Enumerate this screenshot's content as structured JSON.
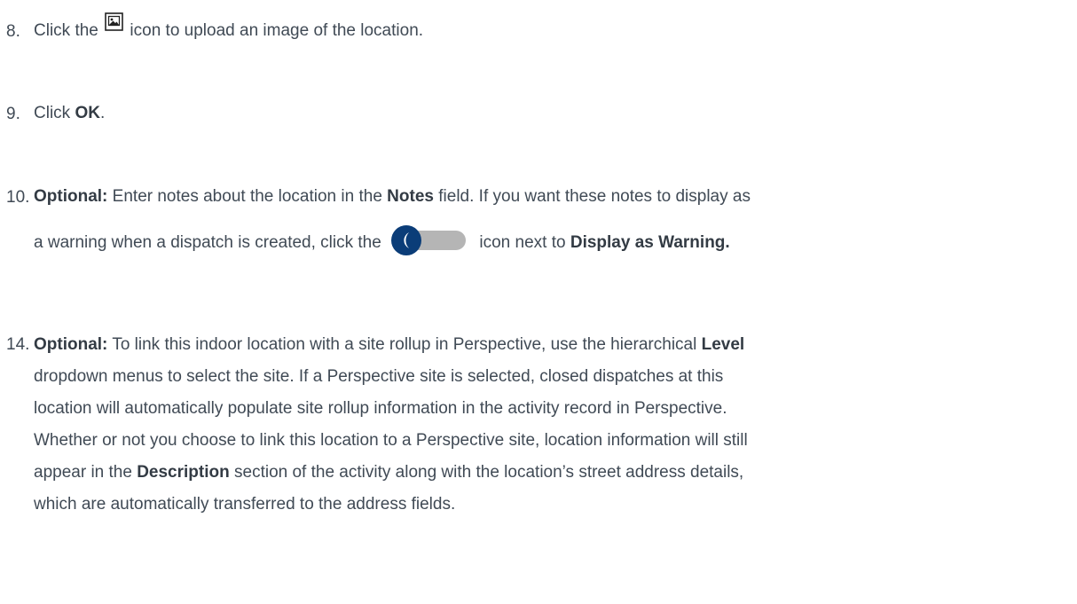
{
  "steps": [
    {
      "number": "8.",
      "parts": [
        "Click the ",
        " icon to upload an image of the location."
      ],
      "icon": "image-upload-icon"
    },
    {
      "number": "9.",
      "prefix": "Click ",
      "bold": "OK",
      "suffix": "."
    },
    {
      "number": "10.",
      "label": "Optional:",
      "line1_a": " Enter notes about the location in the ",
      "line1_bold": "Notes",
      "line1_b": " field. If you want these notes to display as",
      "line2_a": "a warning when a dispatch is created, click the ",
      "line2_b": " icon next to ",
      "line2_bold": "Display as Warning.",
      "icon": "toggle-switch-icon"
    },
    {
      "number": "14.",
      "label": "Optional:",
      "l1_a": " To link this indoor location with a site rollup in Perspective, use the hierarchical ",
      "l1_bold": "Level",
      "l2": "dropdown menus to select the site. If a Perspective site is selected, closed dispatches at this",
      "l3": "location will automatically populate site rollup information in the activity record in Perspective.",
      "l4": "Whether or not you choose to link this location to a Perspective site, location information will still",
      "l5_a": "appear in the ",
      "l5_bold": "Description",
      "l5_b": " section of the activity along with the location’s street address details,",
      "l6": "which are automatically transferred to the address fields."
    }
  ],
  "colors": {
    "text": "#404a55",
    "toggle_knob": "#0b3d78",
    "toggle_track": "#b5b5b5"
  }
}
